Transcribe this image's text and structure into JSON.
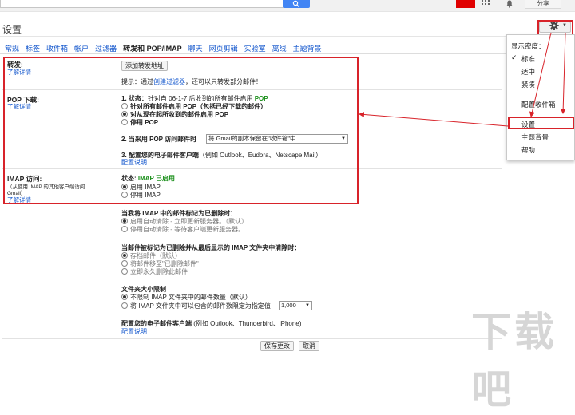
{
  "topbar": {
    "share_label": "分享"
  },
  "page_title": "设置",
  "tabs": [
    {
      "label": "常规"
    },
    {
      "label": "标签"
    },
    {
      "label": "收件箱"
    },
    {
      "label": "帐户"
    },
    {
      "label": "过滤器"
    },
    {
      "label": "转发和 POP/IMAP"
    },
    {
      "label": "聊天"
    },
    {
      "label": "网页剪辑"
    },
    {
      "label": "实验室"
    },
    {
      "label": "离线"
    },
    {
      "label": "主题背景"
    }
  ],
  "forwarding": {
    "label": "转发:",
    "learn_more": "了解详情",
    "add_button": "添加转发地址",
    "tip_prefix": "提示：通过",
    "tip_link": "创建过滤器",
    "tip_suffix": "，还可以只转发部分邮件！"
  },
  "pop": {
    "label": "POP 下载:",
    "learn_more": "了解详情",
    "status_prefix": "1. 状态：",
    "status_text": "针对自 06-1-7 后收到的所有邮件启用",
    "status_value": "POP",
    "options": [
      {
        "text": "针对所有邮件启用 POP（包括已经下载的邮件）",
        "selected": false
      },
      {
        "text": "对从现在起所收到的邮件启用 POP",
        "selected": true
      },
      {
        "text": "停用 POP",
        "selected": false
      }
    ],
    "when_access": "2. 当采用 POP 访问邮件时",
    "when_select": "将 Gmail的副本保留在\"收件箱\"中",
    "configure": "3. 配置您的电子邮件客户端",
    "configure_hint": "（例如 Outlook、Eudora、Netscape Mail）",
    "configure_link": "配置说明"
  },
  "imap": {
    "label": "IMAP 访问:",
    "sub1": "（从使用 IMAP 的其他客户端访问",
    "sub2": "Gmail）",
    "learn_more": "了解详情",
    "status_prefix": "状态: ",
    "status_value": "IMAP 已启用",
    "options": [
      {
        "text": "启用 IMAP",
        "selected": true
      },
      {
        "text": "停用 IMAP",
        "selected": false
      }
    ],
    "deleted_title": "当我将 IMAP 中的邮件标记为已删除时：",
    "deleted_options": [
      {
        "text": "启用自动清除 - 立即更新服务器。（默认）",
        "selected": true
      },
      {
        "text": "停用自动清除 - 等待客户端更新服务器。",
        "selected": false
      }
    ],
    "expunge_title": "当邮件被标记为已删除并从最后显示的 IMAP 文件夹中清除时：",
    "expunge_options": [
      {
        "text": "存档邮件（默认）",
        "selected": true
      },
      {
        "text": "将邮件移至\"已删除邮件\"",
        "selected": false
      },
      {
        "text": "立即永久删除此邮件",
        "selected": false
      }
    ],
    "folder_title": "文件夹大小限制",
    "folder_options": [
      {
        "text": "不限制 IMAP 文件夹中的邮件数量（默认）",
        "selected": true
      },
      {
        "text": "将 IMAP 文件夹中可以包含的邮件数限定为指定值",
        "selected": false
      }
    ],
    "folder_limit": "1,000",
    "configure": "配置您的电子邮件客户端",
    "configure_hint": "(例如 Outlook、Thunderbird、iPhone)",
    "configure_link": "配置说明"
  },
  "footer": {
    "save_label": "保存更改",
    "cancel_label": "取消"
  },
  "menu": {
    "density_label": "显示密度：",
    "items": [
      {
        "label": "标准",
        "checked": true
      },
      {
        "label": "适中",
        "checked": false
      },
      {
        "label": "紧凑",
        "checked": false
      }
    ],
    "configure_inbox": "配置收件箱",
    "settings": "设置",
    "themes": "主题背景",
    "help": "帮助"
  },
  "colors": {
    "highlight_red": "#d8232a",
    "link_blue": "#1155cc",
    "status_green": "#1a8f1a",
    "search_blue": "#4285f4"
  }
}
